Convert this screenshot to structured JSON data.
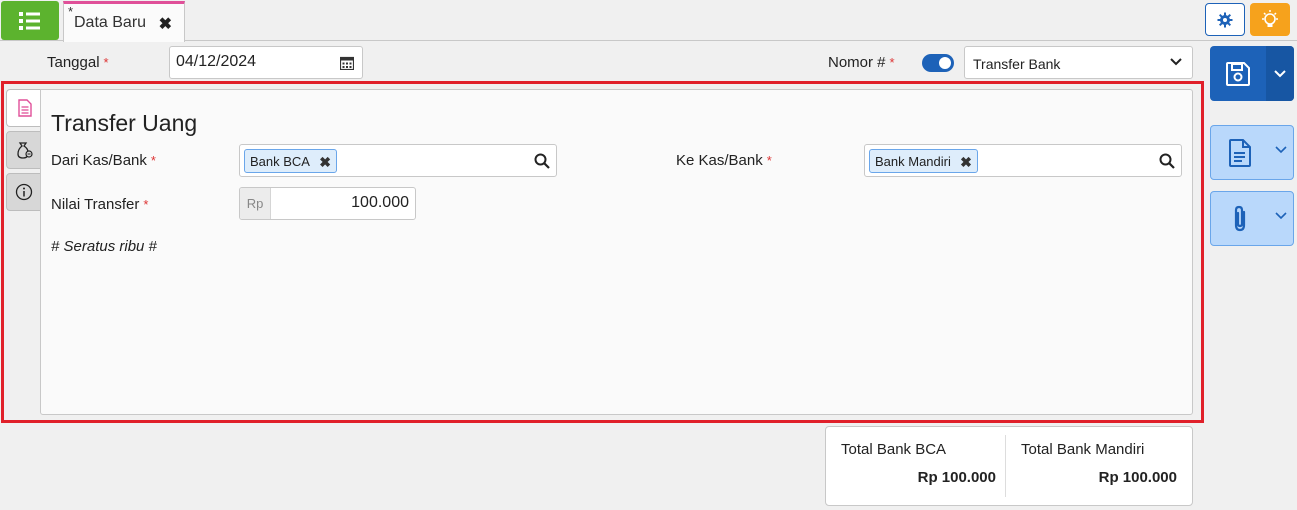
{
  "tabs": [
    {
      "label": "Data Baru",
      "modified_marker": "*"
    }
  ],
  "header": {
    "date_label": "Tanggal",
    "date_value": "04/12/2024",
    "number_label": "Nomor #",
    "required_marker": "*",
    "number_type_selected": "Transfer Bank",
    "auto_number_enabled": true
  },
  "form": {
    "title": "Transfer Uang",
    "from_label": "Dari Kas/Bank",
    "from_value": "Bank BCA",
    "to_label": "Ke Kas/Bank",
    "to_value": "Bank Mandiri",
    "amount_label": "Nilai Transfer",
    "currency_prefix": "Rp",
    "amount_value": "100.000",
    "amount_in_words": "# Seratus ribu #"
  },
  "totals": [
    {
      "label": "Total Bank BCA",
      "value": "Rp 100.000"
    },
    {
      "label": "Total Bank Mandiri",
      "value": "Rp 100.000"
    }
  ],
  "colors": {
    "menu_green": "#5cb32e",
    "primary_blue": "#1d62b8",
    "warning_orange": "#f6a21c",
    "highlight_red": "#e0202a",
    "tab_accent_pink": "#e05099"
  },
  "icons": {
    "menu": "list-icon",
    "settings": "gear-icon",
    "tips": "lightbulb-icon",
    "save": "floppy-disk-icon",
    "document": "document-icon",
    "attachment": "paperclip-icon"
  }
}
